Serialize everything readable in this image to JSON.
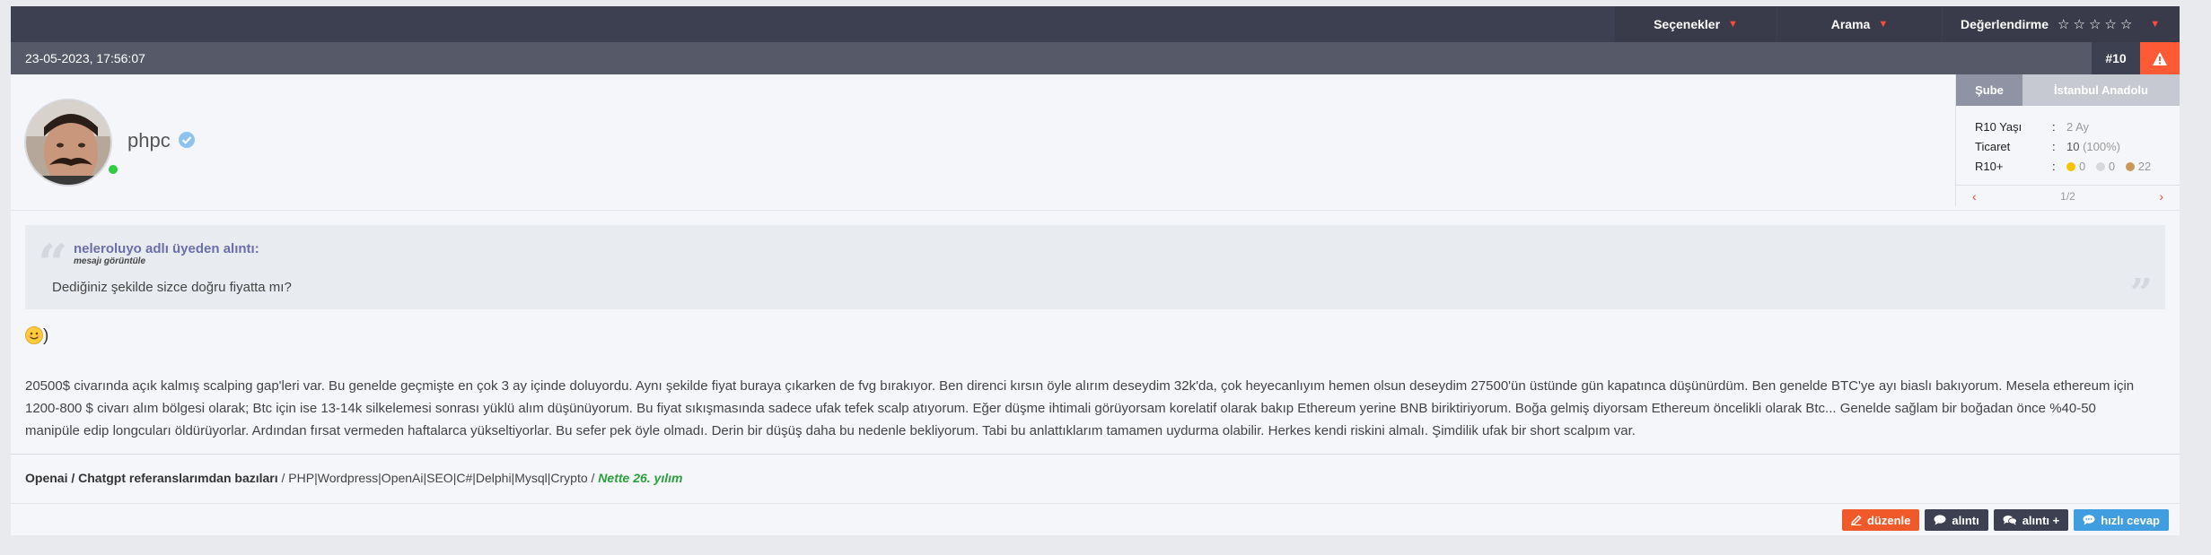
{
  "toolbar": {
    "options_label": "Seçenekler",
    "search_label": "Arama",
    "rating_label": "Değerlendirme",
    "stars": "☆☆☆☆☆"
  },
  "post": {
    "date": "23-05-2023, 17:56:07",
    "number": "#10"
  },
  "user": {
    "name": "phpc",
    "tabs": [
      "Şube",
      "İstanbul Anadolu"
    ],
    "stats": [
      {
        "label": "R10 Yaşı",
        "sep": ":",
        "value": "2 Ay"
      },
      {
        "label": "Ticaret",
        "sep": ":",
        "value": "10",
        "extra": "(100%)"
      },
      {
        "label": "R10+",
        "sep": ":"
      }
    ],
    "medals": {
      "gold": "0",
      "silver": "0",
      "bronze": "22"
    },
    "pager": "1/2"
  },
  "quote": {
    "author": "neleroluyo adlı üyeden alıntı:",
    "view_link": "mesajı görüntüle",
    "text": "Dediğiniz şekilde sizce doğru fiyatta mı?"
  },
  "message": {
    "smile_suffix": ")",
    "body": "20500$ civarında açık kalmış scalping gap'leri var. Bu genelde geçmişte en çok 3 ay içinde doluyordu. Aynı şekilde fiyat buraya çıkarken de fvg bırakıyor. Ben direnci kırsın öyle alırım deseydim 32k'da, çok heyecanlıyım hemen olsun deseydim 27500'ün üstünde gün kapatınca düşünürdüm. Ben genelde BTC'ye ayı biaslı bakıyorum. Mesela ethereum için 1200-800 $ civarı alım bölgesi olarak; Btc için ise 13-14k silkelemesi sonrası yüklü alım düşünüyorum. Bu fiyat sıkışmasında sadece ufak tefek scalp atıyorum. Eğer düşme ihtimali görüyorsam korelatif olarak bakıp Ethereum yerine BNB biriktiriyorum. Boğa gelmiş diyorsam Ethereum öncelikli olarak Btc... Genelde sağlam bir boğadan önce %40-50 manipüle edip longcuları öldürüyorlar. Ardından fırsat vermeden haftalarca yükseltiyorlar. Bu sefer pek öyle olmadı. Derin bir düşüş daha bu nedenle bekliyorum. Tabi bu anlattıklarım tamamen uydurma olabilir. Herkes kendi riskini almalı. Şimdilik ufak bir short scalpım var."
  },
  "signature": {
    "bold": "Openai / Chatgpt referanslarımdan bazıları",
    "plain": " / PHP|Wordpress|OpenAi|SEO|C#|Delphi|Mysql|Crypto / ",
    "green": "Nette 26. yılım"
  },
  "actions": {
    "edit": "düzenle",
    "quote": "alıntı",
    "quote_plus": "alıntı +",
    "quick_reply": "hızlı cevap"
  },
  "colors": {
    "toolbar_bg": "#3d4050",
    "accent_red": "#ff5a36",
    "online": "#2ecc40",
    "quote_author": "#6b6fa8",
    "signature_green": "#2aa13c"
  }
}
